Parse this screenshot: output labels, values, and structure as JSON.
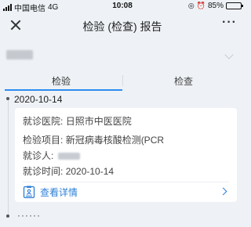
{
  "status_bar": {
    "carrier": "中国电信",
    "network": "4G",
    "time": "10:08",
    "battery_text": "85%",
    "battery_level": 0.85
  },
  "nav": {
    "title": "检验 (检查) 报告",
    "close_icon": "close-icon",
    "more_label": "···"
  },
  "tabs": [
    {
      "label": "检验",
      "active": true
    },
    {
      "label": "检查",
      "active": false
    }
  ],
  "records": [
    {
      "date": "2020-10-14",
      "hospital_label": "就诊医院:",
      "hospital": "日照市中医医院",
      "item_label": "检验项目:",
      "item": "新冠病毒核酸检测(PCR",
      "patient_label": "就诊人:",
      "time_label": "就诊时间:",
      "time": "2020-10-14",
      "details_label": "查看详情"
    }
  ],
  "more_records": "······",
  "colors": {
    "accent": "#2d8cf0",
    "link": "#2d7fd6",
    "background": "#eef2f6"
  }
}
